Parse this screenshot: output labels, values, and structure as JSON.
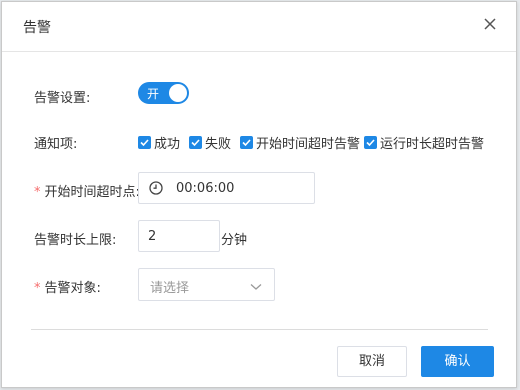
{
  "dialog": {
    "title": "告警"
  },
  "alarm_setting": {
    "label": "告警设置:",
    "switch_text": "开",
    "enabled": true
  },
  "notify": {
    "label": "通知项:",
    "options": [
      {
        "label": "成功",
        "checked": true
      },
      {
        "label": "失败",
        "checked": true
      },
      {
        "label": "开始时间超时告警",
        "checked": true
      },
      {
        "label": "运行时长超时告警",
        "checked": true
      }
    ]
  },
  "start_timeout": {
    "required_mark": "*",
    "label": "开始时间超时点:",
    "value": "00:06:00"
  },
  "duration_limit": {
    "label": "告警时长上限:",
    "value": "2",
    "unit": "分钟"
  },
  "alarm_target": {
    "required_mark": "*",
    "label": "告警对象:",
    "placeholder": "请选择"
  },
  "footer": {
    "cancel_label": "取消",
    "confirm_label": "确认"
  },
  "colors": {
    "primary": "#1e88e5",
    "required": "#f56c6c"
  }
}
